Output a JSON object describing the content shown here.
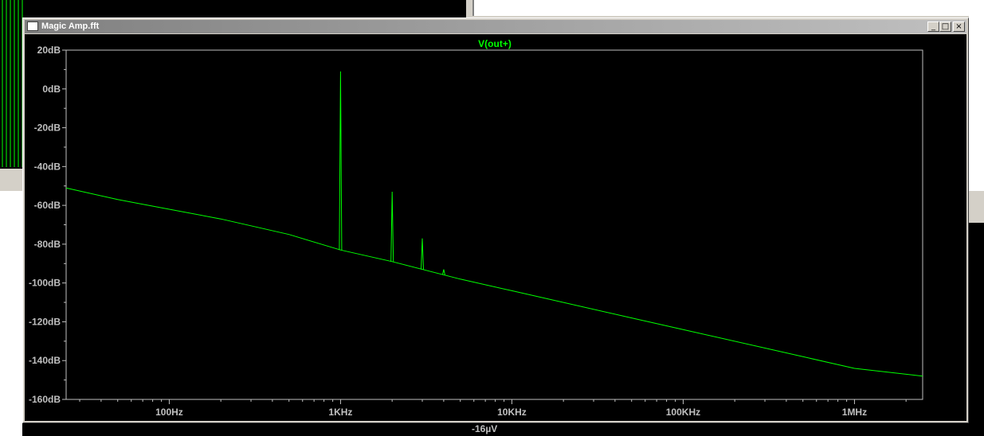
{
  "window": {
    "title": "Magic Amp.fft",
    "buttons": {
      "minimize": "_",
      "maximize": "□",
      "close": "×"
    }
  },
  "background": {
    "bottom_readout": "-16µV"
  },
  "colors": {
    "trace": "#00ff00",
    "axis": "#c0c0c0",
    "plot_bg": "#000000"
  },
  "chart_data": {
    "type": "line",
    "title": "V(out+)",
    "xscale": "log",
    "xlim": [
      25,
      2500000
    ],
    "ylim": [
      -160,
      20
    ],
    "x_ticks": [
      "100Hz",
      "1KHz",
      "10KHz",
      "100KHz",
      "1MHz"
    ],
    "x_tick_values": [
      100,
      1000,
      10000,
      100000,
      1000000
    ],
    "y_ticks": [
      "20dB",
      "0dB",
      "-20dB",
      "-40dB",
      "-60dB",
      "-80dB",
      "-100dB",
      "-120dB",
      "-140dB",
      "-160dB"
    ],
    "y_tick_values": [
      20,
      0,
      -20,
      -40,
      -60,
      -80,
      -100,
      -120,
      -140,
      -160
    ],
    "noise_floor": {
      "x": [
        25,
        50,
        100,
        200,
        500,
        1000,
        2000,
        5000,
        10000,
        50000,
        100000,
        500000,
        1000000,
        2500000
      ],
      "y": [
        -51,
        -57,
        -62,
        -67,
        -75,
        -83,
        -89,
        -98,
        -104,
        -118,
        -124,
        -138,
        -144,
        -148
      ]
    },
    "harmonics": [
      {
        "x": 1000,
        "y": 9
      },
      {
        "x": 2000,
        "y": -53
      },
      {
        "x": 3000,
        "y": -77
      },
      {
        "x": 4000,
        "y": -93
      }
    ]
  }
}
